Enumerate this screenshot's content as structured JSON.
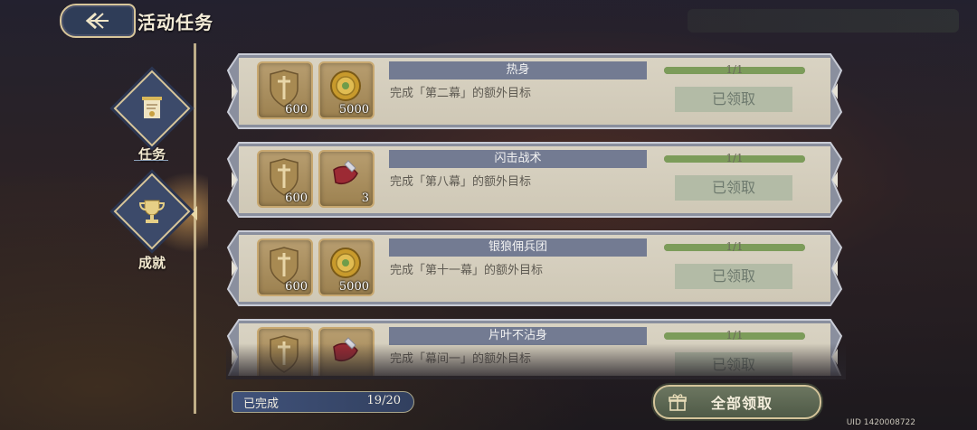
{
  "header": {
    "title": "活动任务",
    "back_icon": "back-arrow-icon"
  },
  "nav": {
    "items": [
      {
        "label": "任务",
        "icon": "scroll-banner-icon",
        "active": false
      },
      {
        "label": "成就",
        "icon": "trophy-icon",
        "active": true
      }
    ]
  },
  "tasks": [
    {
      "name": "热身",
      "desc": "完成「第二幕」的额外目标",
      "progress": "1/1",
      "progress_fraction": 1.0,
      "status": "已领取",
      "rewards": [
        {
          "icon": "sword-shield-icon",
          "qty": "600"
        },
        {
          "icon": "gold-coin-icon",
          "qty": "5000"
        }
      ]
    },
    {
      "name": "闪击战术",
      "desc": "完成「第八幕」的额外目标",
      "progress": "1/1",
      "progress_fraction": 1.0,
      "status": "已领取",
      "rewards": [
        {
          "icon": "sword-shield-icon",
          "qty": "600"
        },
        {
          "icon": "red-cloth-item-icon",
          "qty": "3"
        }
      ]
    },
    {
      "name": "银狼佣兵团",
      "desc": "完成「第十一幕」的额外目标",
      "progress": "1/1",
      "progress_fraction": 1.0,
      "status": "已领取",
      "rewards": [
        {
          "icon": "sword-shield-icon",
          "qty": "600"
        },
        {
          "icon": "gold-coin-icon",
          "qty": "5000"
        }
      ]
    },
    {
      "name": "片叶不沾身",
      "desc": "完成「幕间一」的额外目标",
      "progress": "1/1",
      "progress_fraction": 1.0,
      "status": "已领取",
      "rewards": [
        {
          "icon": "sword-shield-icon",
          "qty": ""
        },
        {
          "icon": "red-cloth-item-icon",
          "qty": ""
        }
      ]
    }
  ],
  "footer": {
    "completed_label": "已完成",
    "completed_count": "19/20",
    "claim_all_label": "全部领取",
    "uid": "UID 1420008722"
  }
}
